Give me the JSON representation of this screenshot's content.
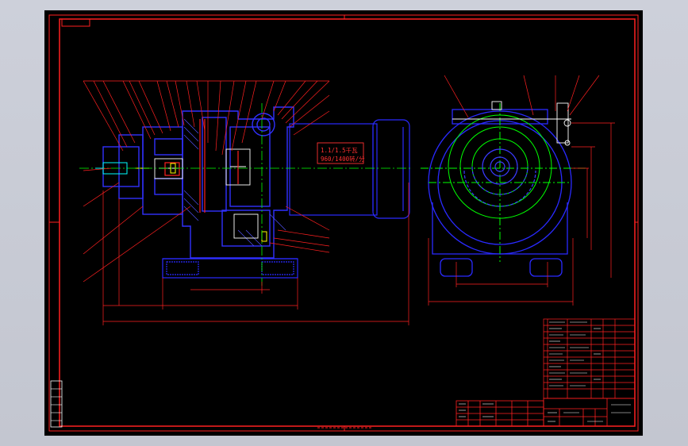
{
  "colors": {
    "background": "#000000",
    "frame": "#ff0000",
    "outline": "#0000ff",
    "centerline": "#00ff00",
    "callout": "#ff0000",
    "annotation": "#ff3030",
    "white": "#ffffff",
    "cyan": "#00ffff",
    "yellow": "#ffff00"
  },
  "annotation": {
    "line1": "1.1/1.5千瓦",
    "line2": "960/1400转/分"
  },
  "icons": [
    "origin-marker-icon",
    "drawing-frame",
    "title-block"
  ]
}
